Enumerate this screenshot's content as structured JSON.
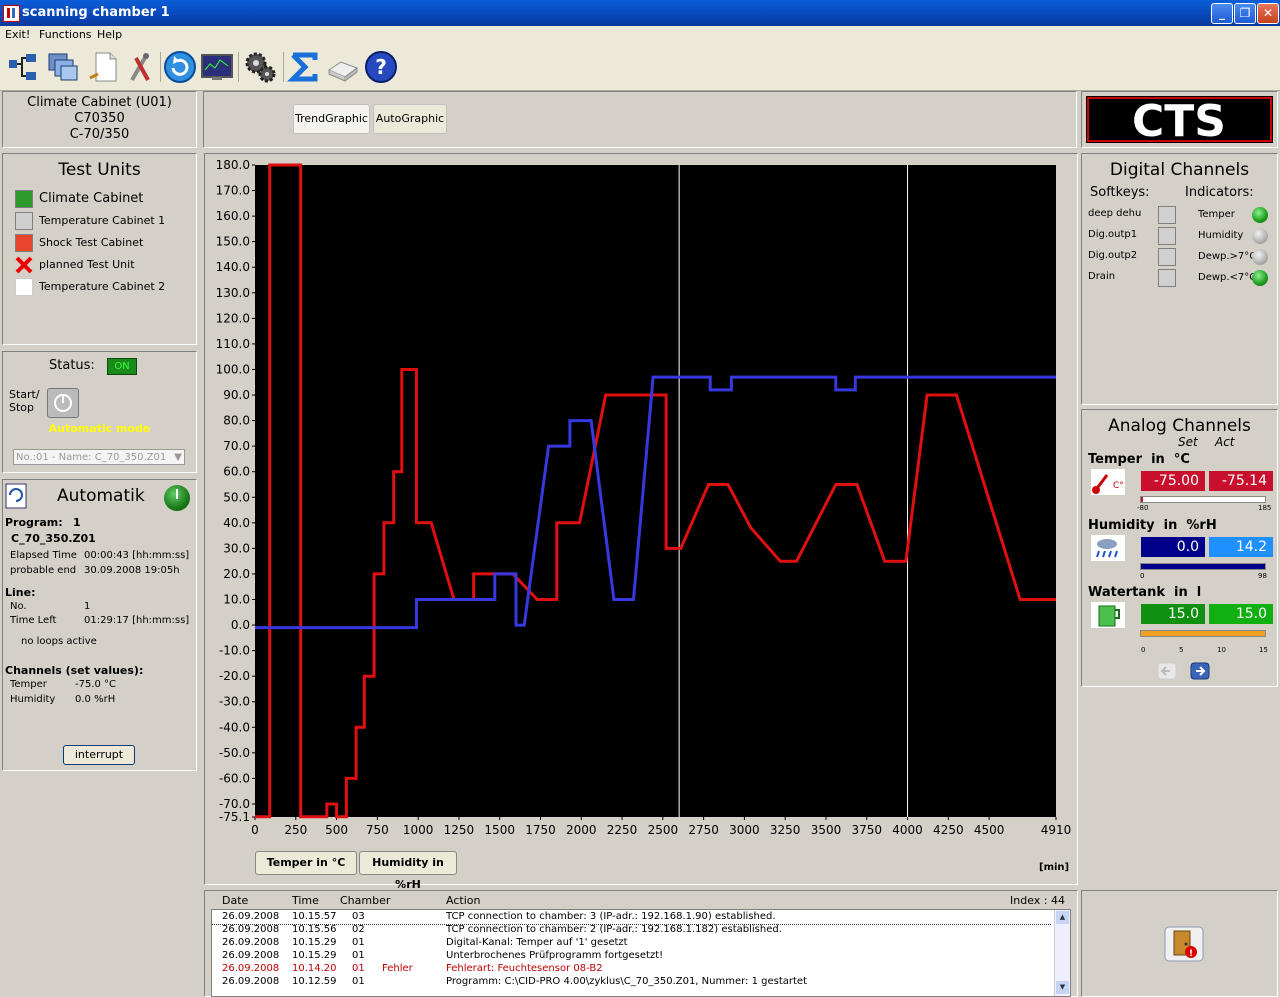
{
  "window": {
    "title": "scanning chamber 1"
  },
  "menu": [
    "Exit!",
    "Functions",
    "Help"
  ],
  "device": {
    "line1": "Climate Cabinet (U01)",
    "line2": "C70350",
    "line3": "C-70/350"
  },
  "tabs": {
    "trend": "TrendGraphic",
    "auto": "AutoGraphic"
  },
  "brand": {
    "logo": "CTS"
  },
  "test_units": {
    "title": "Test Units",
    "items": [
      {
        "label": "Climate Cabinet",
        "color": "#2e9a2e"
      },
      {
        "label": "Temperature Cabinet 1",
        "color": "#cfcfcf"
      },
      {
        "label": "Shock Test Cabinet",
        "color": "#e8452a"
      },
      {
        "label": "planned Test Unit",
        "color": "#e00000"
      },
      {
        "label": "Temperature Cabinet 2",
        "color": "#ffffff"
      }
    ]
  },
  "status": {
    "label": "Status:",
    "value": "ON",
    "startstop": "Start/\nStop",
    "mode": "Automatic mode",
    "program_select": "No.:01 - Name: C_70_350.Z01"
  },
  "automatik": {
    "title": "Automatik",
    "program_label": "Program:",
    "program_no": "1",
    "program_name": "C_70_350.Z01",
    "elapsed_label": "Elapsed Time",
    "elapsed_value": "00:00:43 [hh:mm:ss]",
    "end_label": "probable end",
    "end_value": "30.09.2008 19:05h",
    "line_label": "Line:",
    "no_label": "No.",
    "no_value": "1",
    "left_label": "Time Left",
    "left_value": "01:29:17 [hh:mm:ss]",
    "loops": "no loops active",
    "channels_label": "Channels (set values):",
    "temper_label": "Temper",
    "temper_value": "-75.0 °C",
    "humid_label": "Humidity",
    "humid_value": "0.0 %rH",
    "interrupt": "interrupt"
  },
  "digital": {
    "title": "Digital Channels",
    "softkeys": "Softkeys:",
    "indicators": "Indicators:",
    "rows": [
      {
        "softkey": "deep dehu",
        "indicator": "Temper",
        "state": "on"
      },
      {
        "softkey": "Dig.outp1",
        "indicator": "Humidity",
        "state": "off"
      },
      {
        "softkey": "Dig.outp2",
        "indicator": "Dewp.>7°C",
        "state": "off"
      },
      {
        "softkey": "Drain",
        "indicator": "Dewp.<7°C",
        "state": "on"
      }
    ]
  },
  "analog": {
    "title": "Analog Channels",
    "set": "Set",
    "act": "Act",
    "channels": [
      {
        "name": "Temper  in  °C",
        "set": "-75.00",
        "act": "-75.14",
        "min": "-80",
        "max": "185",
        "set_color": "#c8102e",
        "act_color": "#c8102e",
        "bar_level": 0.02
      },
      {
        "name": "Humidity  in  %rH",
        "set": "0.0",
        "act": "14.2",
        "min": "0",
        "max": "98",
        "set_color": "#00008b",
        "act_color": "#1e90ff",
        "bar_level": 1.0
      },
      {
        "name": "Watertank  in  l",
        "set": "15.0",
        "act": "15.0",
        "min": "0",
        "max": "15",
        "ticks": [
          "0",
          "5",
          "10",
          "15"
        ],
        "set_color": "#109010",
        "act_color": "#10b010",
        "bar_level": 1.0
      }
    ]
  },
  "chart_buttons": {
    "temp": "Temper in °C",
    "humid": "Humidity in %rH",
    "unit": "[min]"
  },
  "chart_data": {
    "type": "line",
    "xlim": [
      0,
      4910
    ],
    "ylim": [
      -75.1,
      180.0
    ],
    "xticks": [
      "0",
      "250",
      "500",
      "750",
      "1000",
      "1250",
      "1500",
      "1750",
      "2000",
      "2250",
      "2500",
      "2750",
      "3000",
      "3250",
      "3500",
      "3750",
      "4000",
      "4250",
      "4500",
      "4910"
    ],
    "yticks": [
      "180.0",
      "170.0",
      "160.0",
      "150.0",
      "140.0",
      "130.0",
      "120.0",
      "110.0",
      "100.0",
      "90.0",
      "80.0",
      "70.0",
      "60.0",
      "50.0",
      "40.0",
      "30.0",
      "20.0",
      "10.0",
      "0.0",
      "-10.0",
      "-20.0",
      "-30.0",
      "-40.0",
      "-50.0",
      "-60.0",
      "-70.0",
      "-75.1"
    ],
    "vlines": [
      2600,
      4000
    ],
    "series": [
      {
        "color": "#e01010",
        "points": [
          [
            0,
            -75
          ],
          [
            90,
            -75
          ],
          [
            90,
            180
          ],
          [
            280,
            180
          ],
          [
            280,
            -75
          ],
          [
            440,
            -75
          ],
          [
            440,
            -70
          ],
          [
            500,
            -70
          ],
          [
            500,
            -75
          ],
          [
            560,
            -75
          ],
          [
            560,
            -60
          ],
          [
            620,
            -60
          ],
          [
            620,
            -40
          ],
          [
            670,
            -40
          ],
          [
            670,
            -20
          ],
          [
            730,
            -20
          ],
          [
            730,
            20
          ],
          [
            790,
            20
          ],
          [
            790,
            40
          ],
          [
            850,
            40
          ],
          [
            850,
            60
          ],
          [
            900,
            60
          ],
          [
            900,
            100
          ],
          [
            990,
            100
          ],
          [
            990,
            40
          ],
          [
            1080,
            40
          ],
          [
            1220,
            10
          ],
          [
            1340,
            10
          ],
          [
            1340,
            20
          ],
          [
            1580,
            20
          ],
          [
            1730,
            10
          ],
          [
            1850,
            10
          ],
          [
            1850,
            40
          ],
          [
            1990,
            40
          ],
          [
            2150,
            90
          ],
          [
            2520,
            90
          ],
          [
            2520,
            30
          ],
          [
            2610,
            30
          ],
          [
            2780,
            55
          ],
          [
            2900,
            55
          ],
          [
            3040,
            38
          ],
          [
            3220,
            25
          ],
          [
            3320,
            25
          ],
          [
            3560,
            55
          ],
          [
            3690,
            55
          ],
          [
            3860,
            25
          ],
          [
            3990,
            25
          ],
          [
            4120,
            90
          ],
          [
            4300,
            90
          ],
          [
            4690,
            10
          ],
          [
            4910,
            10
          ]
        ]
      },
      {
        "color": "#3838e0",
        "points": [
          [
            0,
            -1
          ],
          [
            990,
            -1
          ],
          [
            990,
            10
          ],
          [
            1470,
            10
          ],
          [
            1470,
            20
          ],
          [
            1600,
            20
          ],
          [
            1600,
            0
          ],
          [
            1650,
            0
          ],
          [
            1800,
            70
          ],
          [
            1930,
            70
          ],
          [
            1930,
            80
          ],
          [
            2060,
            80
          ],
          [
            2200,
            10
          ],
          [
            2320,
            10
          ],
          [
            2440,
            97
          ],
          [
            2790,
            97
          ],
          [
            2790,
            92
          ],
          [
            2920,
            92
          ],
          [
            2920,
            97
          ],
          [
            3560,
            97
          ],
          [
            3560,
            92
          ],
          [
            3680,
            92
          ],
          [
            3680,
            97
          ],
          [
            4910,
            97
          ]
        ]
      }
    ]
  },
  "log": {
    "headers": {
      "date": "Date",
      "time": "Time",
      "chamber": "Chamber",
      "action": "Action",
      "index": "Index : 44"
    },
    "rows": [
      {
        "date": "26.09.2008",
        "time": "10.15.57",
        "chamber": "03",
        "flag": "",
        "action": "TCP connection to chamber: 3 (IP-adr.: 192.168.1.90) established.",
        "error": false
      },
      {
        "date": "26.09.2008",
        "time": "10.15.56",
        "chamber": "02",
        "flag": "",
        "action": "TCP connection to chamber: 2 (IP-adr.: 192.168.1.182) established.",
        "error": false
      },
      {
        "date": "26.09.2008",
        "time": "10.15.29",
        "chamber": "01",
        "flag": "",
        "action": "Digital-Kanal: Temper auf '1' gesetzt",
        "error": false
      },
      {
        "date": "26.09.2008",
        "time": "10.15.29",
        "chamber": "01",
        "flag": "",
        "action": "Unterbrochenes Prüfprogramm fortgesetzt!",
        "error": false
      },
      {
        "date": "26.09.2008",
        "time": "10.14.20",
        "chamber": "01",
        "flag": "Fehler",
        "action": "Fehlerart: Feuchtesensor 08-B2",
        "error": true
      },
      {
        "date": "26.09.2008",
        "time": "10.12.59",
        "chamber": "01",
        "flag": "",
        "action": "Programm: C:\\CID-PRO 4.00\\zyklus\\C_70_350.Z01, Nummer: 1 gestartet",
        "error": false
      }
    ]
  }
}
